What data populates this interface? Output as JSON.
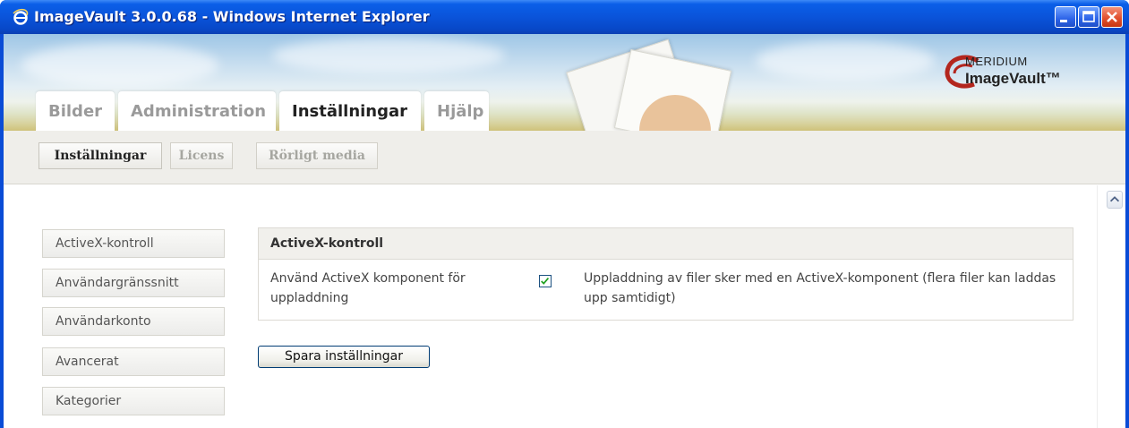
{
  "window": {
    "title": "ImageVault 3.0.0.68 - Windows Internet Explorer",
    "icon": "internet-explorer-icon",
    "buttons": [
      "minimize-icon",
      "maximize-icon",
      "close-icon"
    ]
  },
  "header": {
    "logo_top": "MERIDIUM",
    "logo_bottom": "ImageVault™",
    "tabs": [
      {
        "label": "Bilder",
        "active": false
      },
      {
        "label": "Administration",
        "active": false
      },
      {
        "label": "Inställningar",
        "active": true
      },
      {
        "label": "Hjälp",
        "active": false
      }
    ]
  },
  "subnav": {
    "items": [
      {
        "label": "Inställningar",
        "active": true
      },
      {
        "label": "Licens",
        "active": false
      },
      {
        "label": "Rörligt media",
        "active": false
      }
    ]
  },
  "sidebar": {
    "items": [
      {
        "label": "ActiveX-kontroll"
      },
      {
        "label": "Användargränssnitt"
      },
      {
        "label": "Användarkonto"
      },
      {
        "label": "Avancerat"
      },
      {
        "label": "Kategorier"
      }
    ]
  },
  "panel": {
    "title": "ActiveX-kontroll",
    "field_label": "Använd ActiveX komponent för uppladdning",
    "checked": true,
    "description": "Uppladdning av filer sker med en ActiveX-komponent (flera filer kan laddas upp samtidigt)"
  },
  "save_button": "Spara inställningar",
  "colors": {
    "titlebar": "#0a55dc",
    "checkmark": "#21a121"
  }
}
